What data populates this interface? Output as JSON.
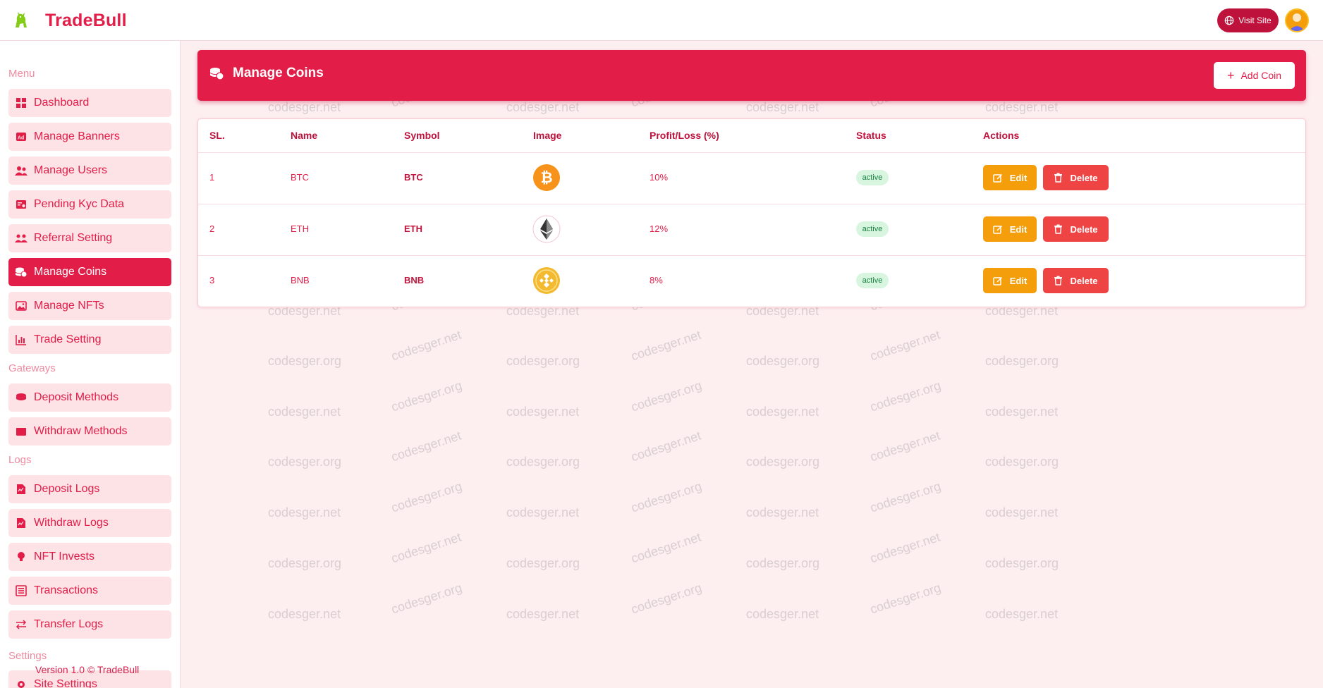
{
  "app": {
    "name": "TradeBull",
    "visit_site_label": "Visit Site",
    "version_text": "Version 1.0 © TradeBull",
    "watermark_a": "codesger.org",
    "watermark_b": "codesger.net"
  },
  "sidebar": {
    "sections": [
      {
        "title": "Menu"
      },
      {
        "title": "Gateways"
      },
      {
        "title": "Logs"
      },
      {
        "title": "Settings"
      }
    ],
    "items": [
      {
        "label": "Dashboard",
        "icon": "dashboard-icon"
      },
      {
        "label": "Manage Banners",
        "icon": "ad-icon"
      },
      {
        "label": "Manage Users",
        "icon": "users-icon"
      },
      {
        "label": "Pending Kyc Data",
        "icon": "id-card-icon"
      },
      {
        "label": "Referral Setting",
        "icon": "referral-icon"
      },
      {
        "label": "Manage Coins",
        "icon": "coins-icon",
        "active": true
      },
      {
        "label": "Manage NFTs",
        "icon": "image-icon"
      },
      {
        "label": "Trade Setting",
        "icon": "bar-chart-icon"
      },
      {
        "label": "Deposit Methods",
        "icon": "coin-stack-icon"
      },
      {
        "label": "Withdraw Methods",
        "icon": "wallet-icon"
      },
      {
        "label": "Deposit Logs",
        "icon": "file-chart-icon"
      },
      {
        "label": "Withdraw Logs",
        "icon": "file-chart-icon"
      },
      {
        "label": "NFT Invests",
        "icon": "bulb-icon"
      },
      {
        "label": "Transactions",
        "icon": "list-icon"
      },
      {
        "label": "Transfer Logs",
        "icon": "transfer-icon"
      },
      {
        "label": "Site Settings",
        "icon": "gear-icon"
      }
    ]
  },
  "page": {
    "title": "Manage Coins",
    "add_button_label": "Add Coin"
  },
  "table": {
    "headers": [
      "SL.",
      "Name",
      "Symbol",
      "Image",
      "Profit/Loss (%)",
      "Status",
      "Actions"
    ],
    "rows": [
      {
        "sl": "1",
        "name": "BTC",
        "symbol": "BTC",
        "image": "bitcoin-logo-icon",
        "profit_loss": "10%",
        "status": "active"
      },
      {
        "sl": "2",
        "name": "ETH",
        "symbol": "ETH",
        "image": "ethereum-logo-icon",
        "profit_loss": "12%",
        "status": "active"
      },
      {
        "sl": "3",
        "name": "BNB",
        "symbol": "BNB",
        "image": "bnb-logo-icon",
        "profit_loss": "8%",
        "status": "active"
      }
    ],
    "edit_label": "Edit",
    "delete_label": "Delete"
  },
  "colors": {
    "brand": "#e11d48",
    "brand_dark": "#be123c",
    "sidebar_item_bg": "#fde2e6",
    "edit": "#f59e0b",
    "delete": "#ef4444",
    "status_bg": "#d8f5e0",
    "status_text": "#15803d"
  }
}
